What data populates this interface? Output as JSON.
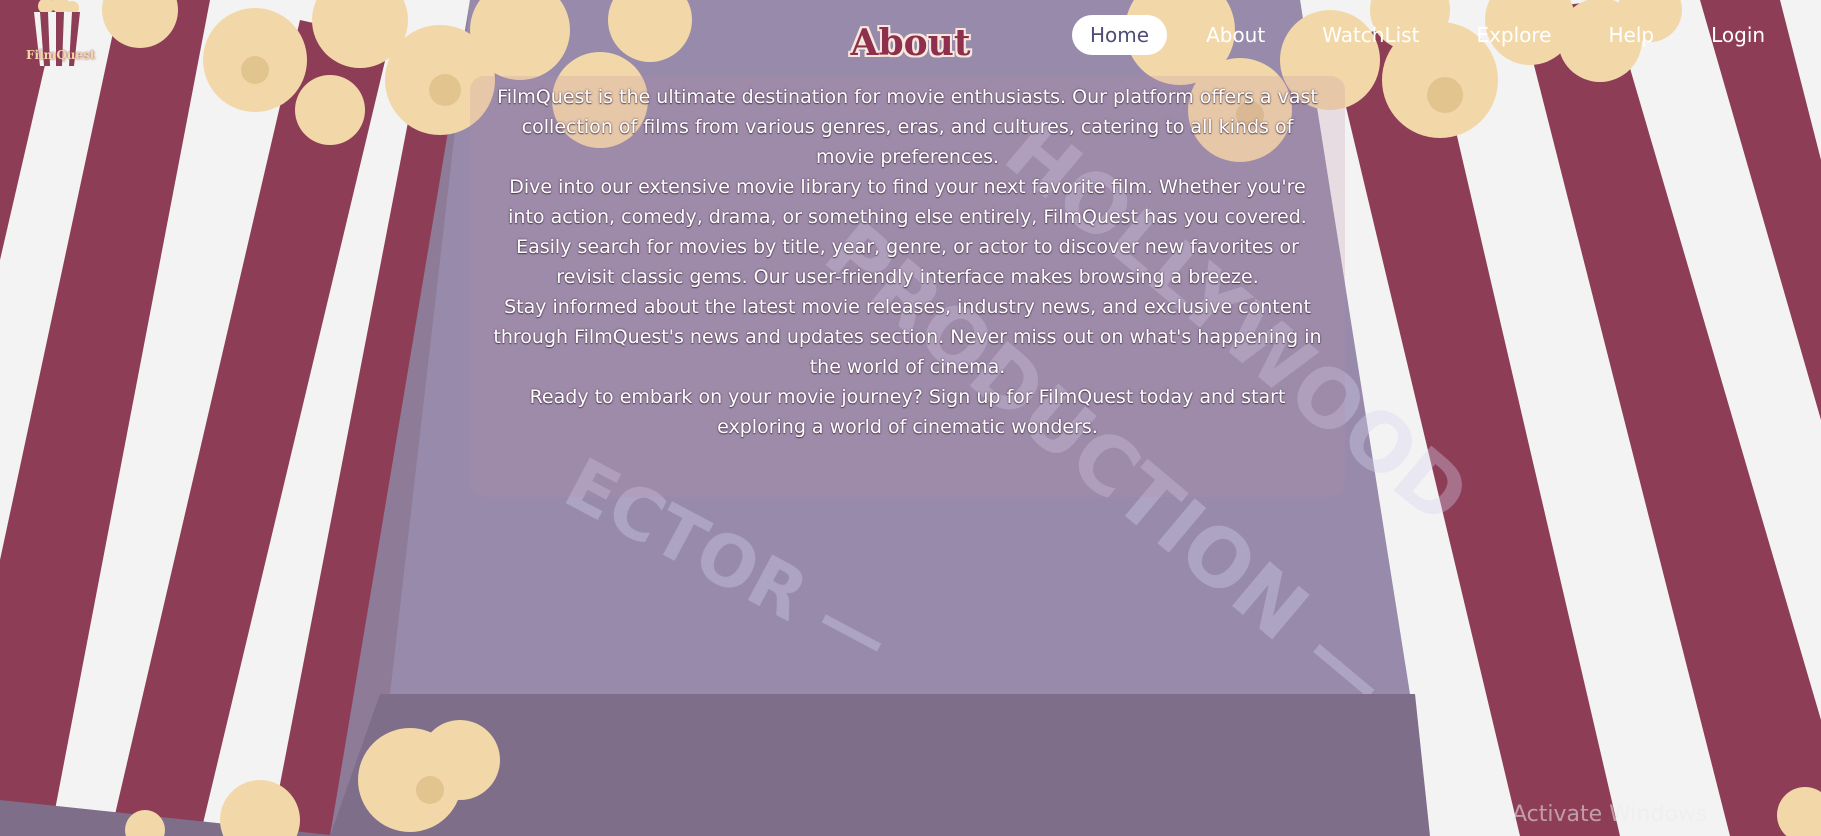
{
  "brand": {
    "logo_text": "FilmQuest"
  },
  "nav": {
    "items": [
      {
        "label": "Home",
        "active": true
      },
      {
        "label": "About",
        "active": false
      },
      {
        "label": "WatchList",
        "active": false
      },
      {
        "label": "Explore",
        "active": false
      },
      {
        "label": "Help",
        "active": false
      },
      {
        "label": "Login",
        "active": false
      }
    ]
  },
  "page": {
    "title": "About",
    "paragraphs": [
      "FilmQuest is the ultimate destination for movie enthusiasts. Our platform offers a vast collection of films from various genres, eras, and cultures, catering to all kinds of movie preferences.",
      "Dive into our extensive movie library to find your next favorite film. Whether you're into action, comedy, drama, or something else entirely, FilmQuest has you covered.",
      "Easily search for movies by title, year, genre, or actor to discover new favorites or revisit classic gems. Our user-friendly interface makes browsing a breeze.",
      "Stay informed about the latest movie releases, industry news, and exclusive content through FilmQuest's news and updates section. Never miss out on what's happening in the world of cinema.",
      "Ready to embark on your movie journey? Sign up for FilmQuest today and start exploring a world of cinematic wonders."
    ]
  },
  "os": {
    "watermark": "Activate Windows"
  },
  "colors": {
    "stripe_red": "#8e3d57",
    "stripe_white": "#f3f3f3",
    "popcorn": "#f2d8a8",
    "clapper_overlay": "#7e6e89",
    "title_red": "#8e2f4e"
  }
}
